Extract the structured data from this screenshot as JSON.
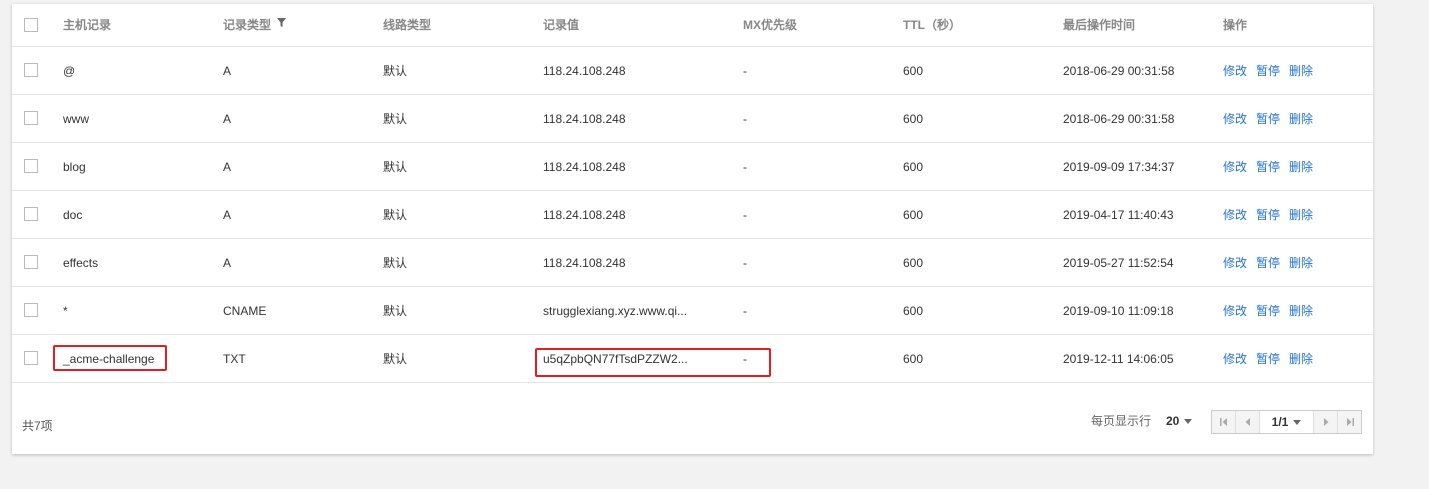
{
  "table": {
    "headers": {
      "host": "主机记录",
      "type": "记录类型",
      "line": "线路类型",
      "value": "记录值",
      "mx": "MX优先级",
      "ttl": "TTL（秒）",
      "time": "最后操作时间",
      "ops": "操作"
    },
    "actions": {
      "edit": "修改",
      "pause": "暂停",
      "delete": "删除"
    },
    "rows": [
      {
        "host": "@",
        "type": "A",
        "line": "默认",
        "value": "118.24.108.248",
        "mx": "-",
        "ttl": "600",
        "time": "2018-06-29 00:31:58"
      },
      {
        "host": "www",
        "type": "A",
        "line": "默认",
        "value": "118.24.108.248",
        "mx": "-",
        "ttl": "600",
        "time": "2018-06-29 00:31:58"
      },
      {
        "host": "blog",
        "type": "A",
        "line": "默认",
        "value": "118.24.108.248",
        "mx": "-",
        "ttl": "600",
        "time": "2019-09-09 17:34:37"
      },
      {
        "host": "doc",
        "type": "A",
        "line": "默认",
        "value": "118.24.108.248",
        "mx": "-",
        "ttl": "600",
        "time": "2019-04-17 11:40:43"
      },
      {
        "host": "effects",
        "type": "A",
        "line": "默认",
        "value": "118.24.108.248",
        "mx": "-",
        "ttl": "600",
        "time": "2019-05-27 11:52:54"
      },
      {
        "host": "*",
        "type": "CNAME",
        "line": "默认",
        "value": "strugglexiang.xyz.www.qi...",
        "mx": "-",
        "ttl": "600",
        "time": "2019-09-10 11:09:18"
      },
      {
        "host": "_acme-challenge",
        "type": "TXT",
        "line": "默认",
        "value": "u5qZpbQN77fTsdPZZW2...",
        "mx": "-",
        "ttl": "600",
        "time": "2019-12-11 14:06:05"
      }
    ]
  },
  "footer": {
    "total": "共7项",
    "per_page_label": "每页显示行",
    "per_page_value": "20",
    "page_indicator": "1/1"
  },
  "colors": {
    "link": "#2673d6",
    "highlight": "#e02020"
  }
}
